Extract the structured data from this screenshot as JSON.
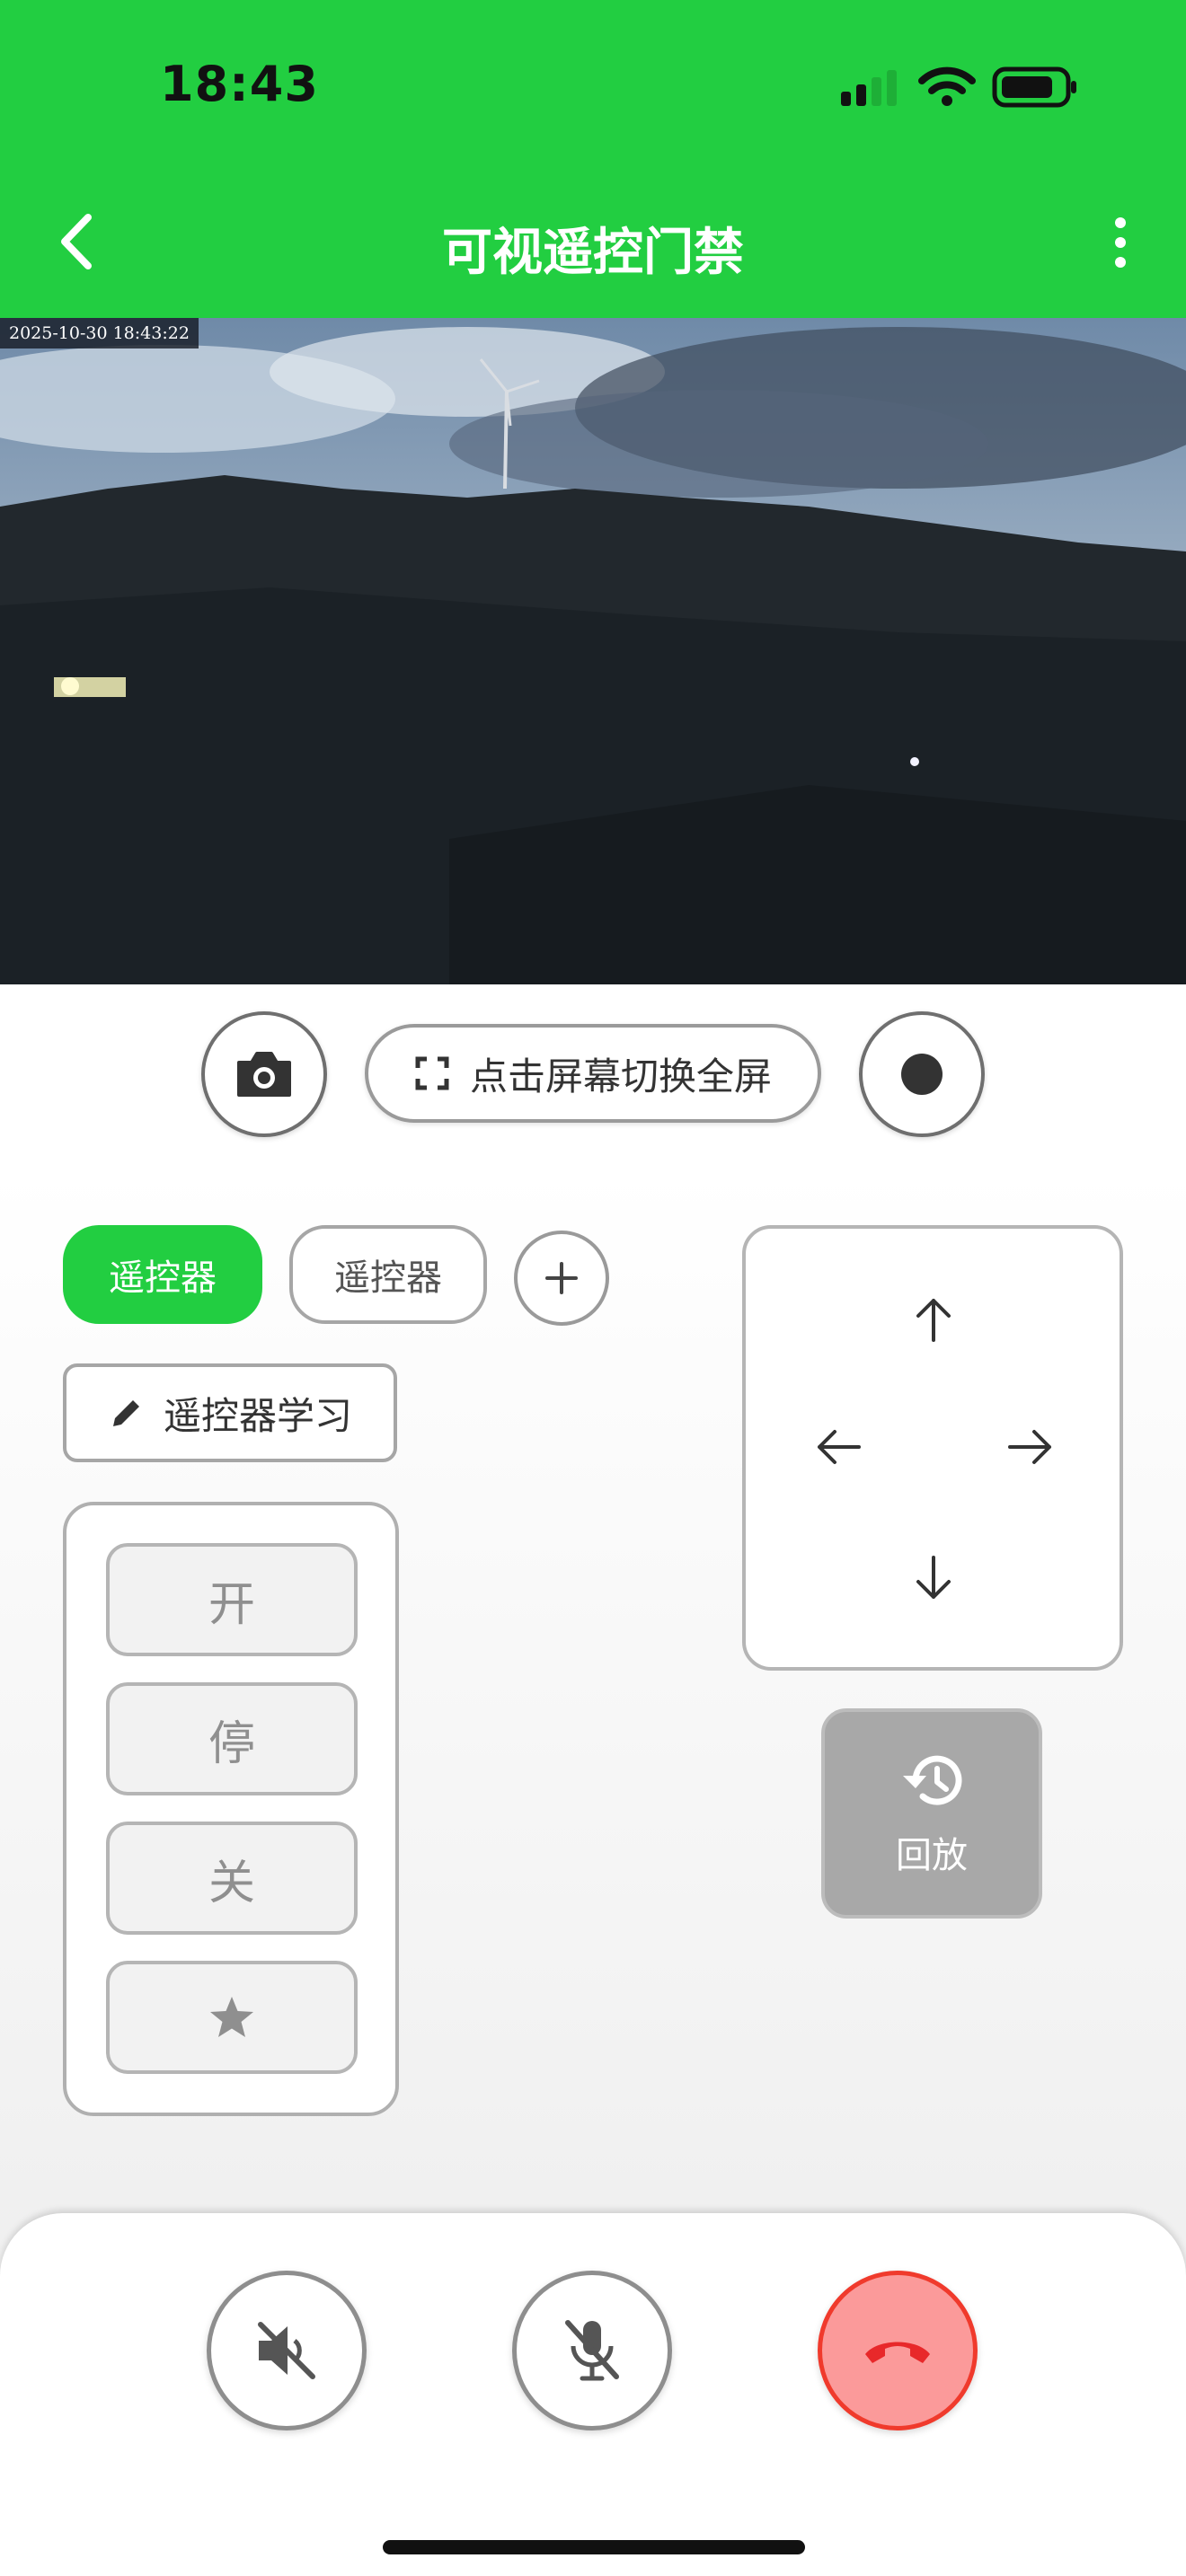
{
  "status_bar": {
    "time": "18:43"
  },
  "nav": {
    "title": "可视遥控门禁"
  },
  "video": {
    "timestamp": "2025-10-30   18:43:22"
  },
  "toolbar": {
    "fullscreen_label": "点击屏幕切换全屏"
  },
  "remotes": {
    "tabs": [
      {
        "label": "遥控器",
        "active": true
      },
      {
        "label": "遥控器",
        "active": false
      }
    ],
    "learn_label": "遥控器学习",
    "keys": [
      {
        "label": "开"
      },
      {
        "label": "停"
      },
      {
        "label": "关"
      }
    ],
    "star_icon": "star-icon"
  },
  "playback": {
    "label": "回放",
    "icon": "history-icon"
  },
  "call_controls": {
    "speaker_icon": "speaker-muted-icon",
    "mic_icon": "mic-muted-icon",
    "hangup_icon": "phone-hangup-icon"
  },
  "colors": {
    "accent": "#22ce41",
    "hangup": "#f03a2c",
    "playback_bg": "#a8a8a8"
  }
}
